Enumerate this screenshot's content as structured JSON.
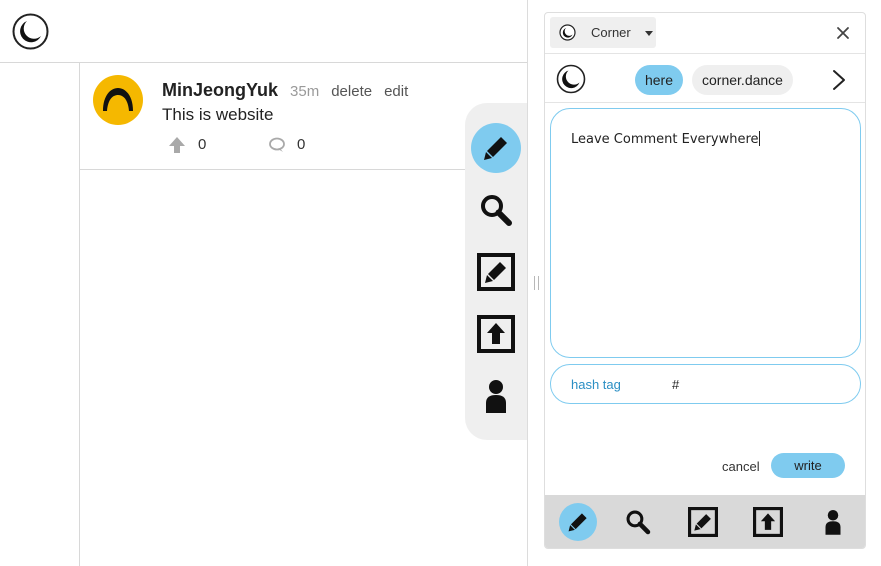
{
  "post": {
    "username": "MinJeongYuk",
    "time": "35m",
    "delete_label": "delete",
    "edit_label": "edit",
    "body": "This is website",
    "upvotes": "0",
    "comments": "0"
  },
  "tool_panel": {
    "items": [
      "pencil-icon",
      "search-icon",
      "edit-box-icon",
      "upload-box-icon",
      "user-icon"
    ],
    "active": "pencil-icon"
  },
  "ext": {
    "selected_site": "Corner",
    "tabs": [
      {
        "label": "here",
        "active": true
      },
      {
        "label": "corner.dance",
        "active": false
      }
    ],
    "comment_text": "Leave Comment Everywhere",
    "hashtag_label": "hash tag",
    "hashtag_value": "#",
    "cancel_label": "cancel",
    "write_label": "write",
    "footer_active": "pencil-icon"
  },
  "colors": {
    "accent": "#7fcbef",
    "avatar": "#f5b800",
    "panel_bg": "#efefef",
    "footer_bg": "#d9d9d9",
    "link_blue": "#2b8fc4"
  }
}
